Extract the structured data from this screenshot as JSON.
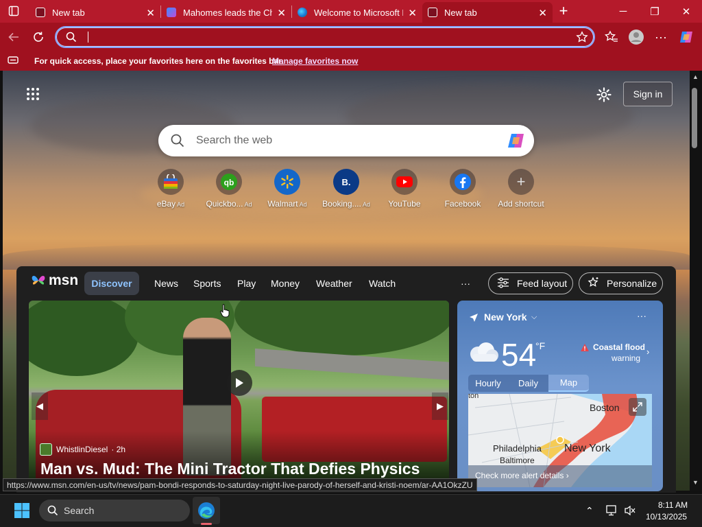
{
  "tabs": [
    {
      "label": "New tab"
    },
    {
      "label": "Mahomes leads the Chi"
    },
    {
      "label": "Welcome to Microsoft E"
    },
    {
      "label": "New tab"
    }
  ],
  "favorites_bar": {
    "message": "For quick access, place your favorites here on the favorites bar.",
    "link": "Manage favorites now"
  },
  "newtab": {
    "sign_in": "Sign in",
    "search_placeholder": "Search the web",
    "shortcuts": [
      {
        "label": "eBay",
        "ad": "Ad"
      },
      {
        "label": "Quickbo...",
        "ad": "Ad"
      },
      {
        "label": "Walmart",
        "ad": "Ad"
      },
      {
        "label": "Booking....",
        "ad": "Ad"
      },
      {
        "label": "YouTube",
        "ad": ""
      },
      {
        "label": "Facebook",
        "ad": ""
      },
      {
        "label": "Add shortcut",
        "ad": ""
      }
    ]
  },
  "msn": {
    "logo": "msn",
    "nav": [
      "Discover",
      "News",
      "Sports",
      "Play",
      "Money",
      "Weather",
      "Watch"
    ],
    "more": "···",
    "feed_layout": "Feed layout",
    "personalize": "Personalize",
    "hero": {
      "source": "WhistlinDiesel",
      "age": "· 2h",
      "headline": "Man vs. Mud: The Mini Tractor That Defies Physics"
    },
    "weather": {
      "location": "New York",
      "temp": "54",
      "unit": "°F",
      "alert_line1": "Coastal flood",
      "alert_line2": "warning",
      "tabs": [
        "Hourly",
        "Daily",
        "Map"
      ],
      "map_labels": [
        "ton",
        "Boston",
        "Philadelphia",
        "Baltimore",
        "New York"
      ],
      "map_link": "Check more alert details"
    }
  },
  "status_url": "https://www.msn.com/en-us/tv/news/pam-bondi-responds-to-saturday-night-live-parody-of-herself-and-kristi-noem/ar-AA1OkzZU",
  "taskbar": {
    "search": "Search",
    "time": "8:11 AM",
    "date": "10/13/2025"
  }
}
